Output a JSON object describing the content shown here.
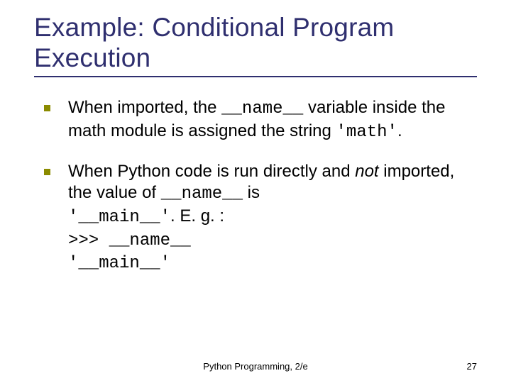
{
  "title": "Example: Conditional Program Execution",
  "bullets": [
    {
      "pre": "When imported, the ",
      "code1": "__name__",
      "mid": " variable inside the math module is assigned the string ",
      "quoted": "'math'",
      "post": "."
    },
    {
      "line1_a": "When Python code is run directly and ",
      "line1_not": "not",
      "line1_b": " imported, the value of ",
      "line1_code": "__name__",
      "line1_c": " is ",
      "line2_quoted": "'__main__'",
      "line2_post": ". E. g. :",
      "line3": ">>> __name__",
      "line4": "'__main__'"
    }
  ],
  "footer": {
    "center": "Python Programming, 2/e",
    "page": "27"
  }
}
